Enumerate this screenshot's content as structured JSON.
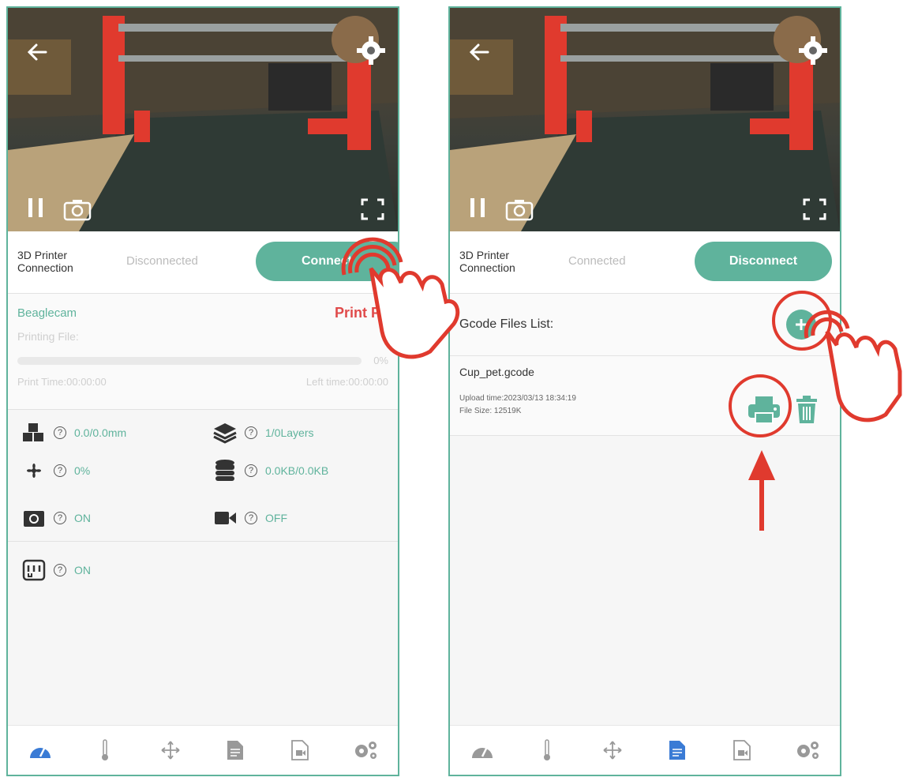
{
  "left": {
    "connection": {
      "label": "3D Printer\nConnection",
      "status": "Disconnected",
      "button": "Connect"
    },
    "print": {
      "camera_name": "Beaglecam",
      "status_label": "Print PE",
      "printing_file": "Printing File:",
      "progress_percent": 0,
      "progress_label": "0%",
      "print_time": "Print Time:00:00:00",
      "left_time": "Left time:00:00:00"
    },
    "stats": {
      "height": "0.0/0.0mm",
      "layers": "1/0Layers",
      "fan": "0%",
      "storage": "0.0KB/0.0KB",
      "camera_switch": "ON",
      "record": "OFF",
      "uv": "ON"
    },
    "stat_help": "?"
  },
  "right": {
    "connection": {
      "label": "3D Printer\nConnection",
      "status": "Connected",
      "button": "Disconnect"
    },
    "gcode": {
      "title": "Gcode Files List:",
      "file_name": "Cup_pet.gcode",
      "upload_time": "Upload time:2023/03/13 18:34:19",
      "file_size": "File Size: 12519K"
    }
  },
  "colors": {
    "accent": "#5fb39c",
    "alert": "#e04a4a",
    "active_nav": "#3a7bd5",
    "frame": "#5fb39c"
  },
  "icons": {
    "camera": [
      "back-arrow-icon",
      "gear-icon",
      "pause-icon",
      "camera-icon",
      "fullscreen-icon"
    ],
    "nav": [
      "dashboard-icon",
      "thermometer-icon",
      "move-icon",
      "file-list-icon",
      "video-file-icon",
      "settings-icon"
    ]
  }
}
